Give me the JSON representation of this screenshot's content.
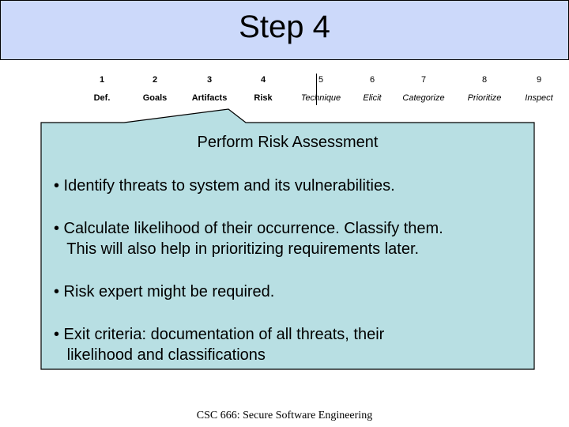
{
  "title": "Step 4",
  "steps": [
    {
      "num": "1",
      "label": "Def.",
      "style": "bold"
    },
    {
      "num": "2",
      "label": "Goals",
      "style": "bold"
    },
    {
      "num": "3",
      "label": "Artifacts",
      "style": "bold"
    },
    {
      "num": "4",
      "label": "Risk",
      "style": "bold"
    },
    {
      "num": "5",
      "label": "Technique",
      "style": "italic"
    },
    {
      "num": "6",
      "label": "Elicit",
      "style": "italic"
    },
    {
      "num": "7",
      "label": "Categorize",
      "style": "italic"
    },
    {
      "num": "8",
      "label": "Prioritize",
      "style": "italic"
    },
    {
      "num": "9",
      "label": "Inspect",
      "style": "italic"
    }
  ],
  "current_step": "4",
  "content": {
    "heading": "Perform Risk Assessment",
    "bullets": [
      "• Identify threats to system and its vulnerabilities.",
      "• Calculate likelihood of their occurrence. Classify them.\n   This will also help in prioritizing requirements later.",
      "• Risk expert might be required.",
      "• Exit criteria: documentation of all threats, their\n   likelihood and classifications"
    ]
  },
  "footer": "CSC 666: Secure Software Engineering",
  "colors": {
    "title_bg": "#ccd9fa",
    "callout_bg": "#b8dfe3"
  }
}
